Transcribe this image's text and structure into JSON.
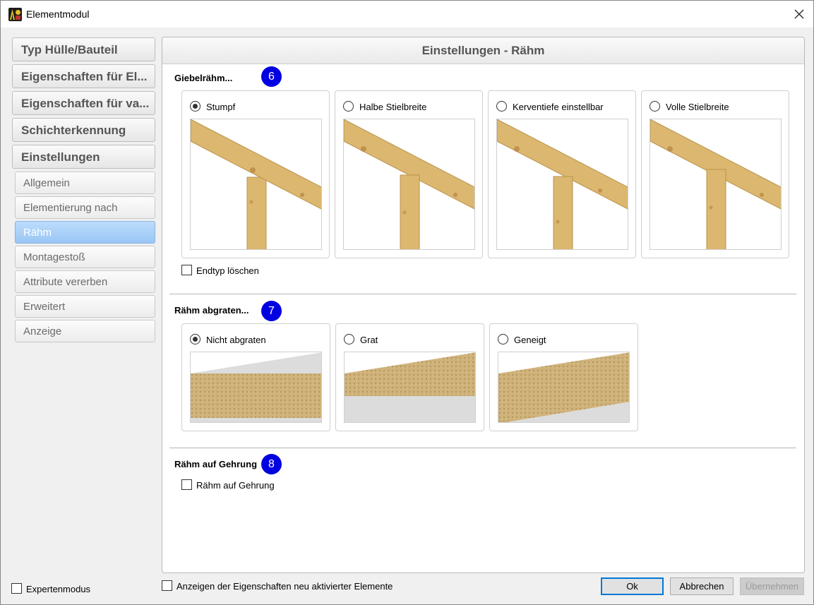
{
  "window": {
    "title": "Elementmodul"
  },
  "nav": {
    "main": [
      {
        "label": "Typ Hülle/Bauteil"
      },
      {
        "label": "Eigenschaften für El..."
      },
      {
        "label": "Eigenschaften für va..."
      },
      {
        "label": "Schichterkennung"
      },
      {
        "label": "Einstellungen"
      }
    ],
    "sub": [
      {
        "label": "Allgemein"
      },
      {
        "label": "Elementierung nach"
      },
      {
        "label": "Rähm"
      },
      {
        "label": "Montagestoß"
      },
      {
        "label": "Attribute vererben"
      },
      {
        "label": "Erweitert"
      },
      {
        "label": "Anzeige"
      }
    ],
    "active": "Rähm"
  },
  "panel": {
    "title": "Einstellungen - Rähm",
    "sections": [
      {
        "title": "Giebelrähm...",
        "badge": "6",
        "options": [
          {
            "label": "Stumpf",
            "checked": true
          },
          {
            "label": "Halbe Stielbreite",
            "checked": false
          },
          {
            "label": "Kerventiefe einstellbar",
            "checked": false
          },
          {
            "label": "Volle Stielbreite",
            "checked": false
          }
        ],
        "checkbox": {
          "label": "Endtyp löschen",
          "checked": false
        }
      },
      {
        "title": "Rähm abgraten...",
        "badge": "7",
        "options": [
          {
            "label": "Nicht abgraten",
            "checked": true
          },
          {
            "label": "Grat",
            "checked": false
          },
          {
            "label": "Geneigt",
            "checked": false
          }
        ]
      },
      {
        "title": "Rähm auf Gehrung",
        "badge": "8",
        "checkbox": {
          "label": "Rähm auf Gehrung",
          "checked": false
        }
      }
    ]
  },
  "footer": {
    "expert_mode": "Expertenmodus",
    "show_properties": "Anzeigen der Eigenschaften neu aktivierter Elemente",
    "ok": "Ok",
    "cancel": "Abbrechen",
    "apply": "Übernehmen"
  },
  "colors": {
    "wood": "#dcb76f",
    "wood_edge": "#b8934c",
    "badge": "#0000e0",
    "active_nav": "#a8cff6"
  }
}
